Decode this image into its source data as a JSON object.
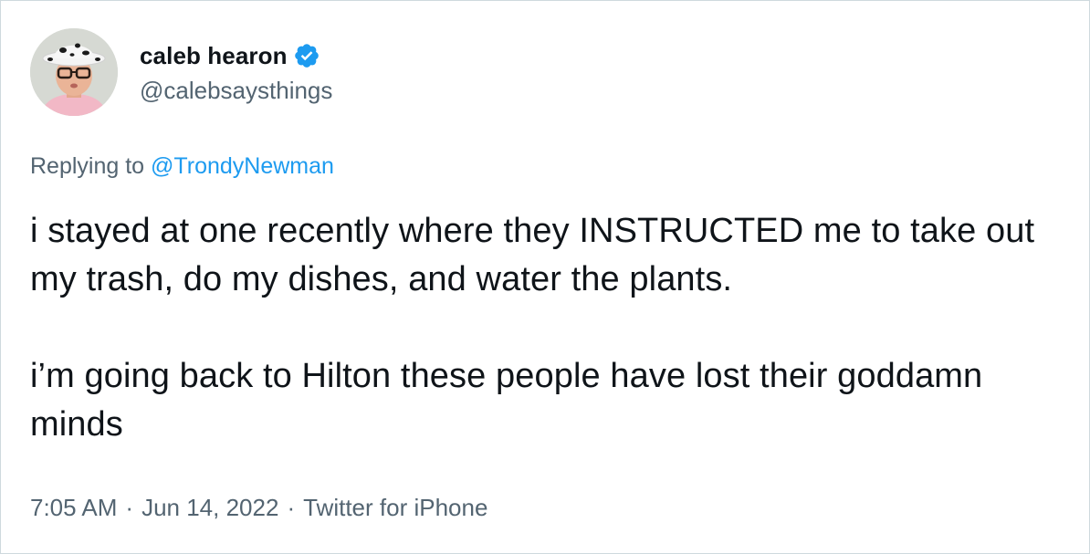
{
  "user": {
    "display_name": "caleb hearon",
    "handle": "@calebsaysthings",
    "verified_icon": "verified-badge-icon",
    "verified_color": "#1d9bf0"
  },
  "reply": {
    "prefix": "Replying to ",
    "handle": "@TrondyNewman"
  },
  "tweet": {
    "paragraphs": [
      "i stayed at one recently where they INSTRUCTED me to take out my trash, do my dishes, and water the plants.",
      "i’m going back to Hilton these people have lost their goddamn minds"
    ]
  },
  "meta": {
    "time": "7:05 AM",
    "separator": "·",
    "date": "Jun 14, 2022",
    "source": "Twitter for iPhone"
  },
  "colors": {
    "text": "#0f1419",
    "secondary": "#536471",
    "link": "#1d9bf0",
    "border": "#cfd9de"
  }
}
